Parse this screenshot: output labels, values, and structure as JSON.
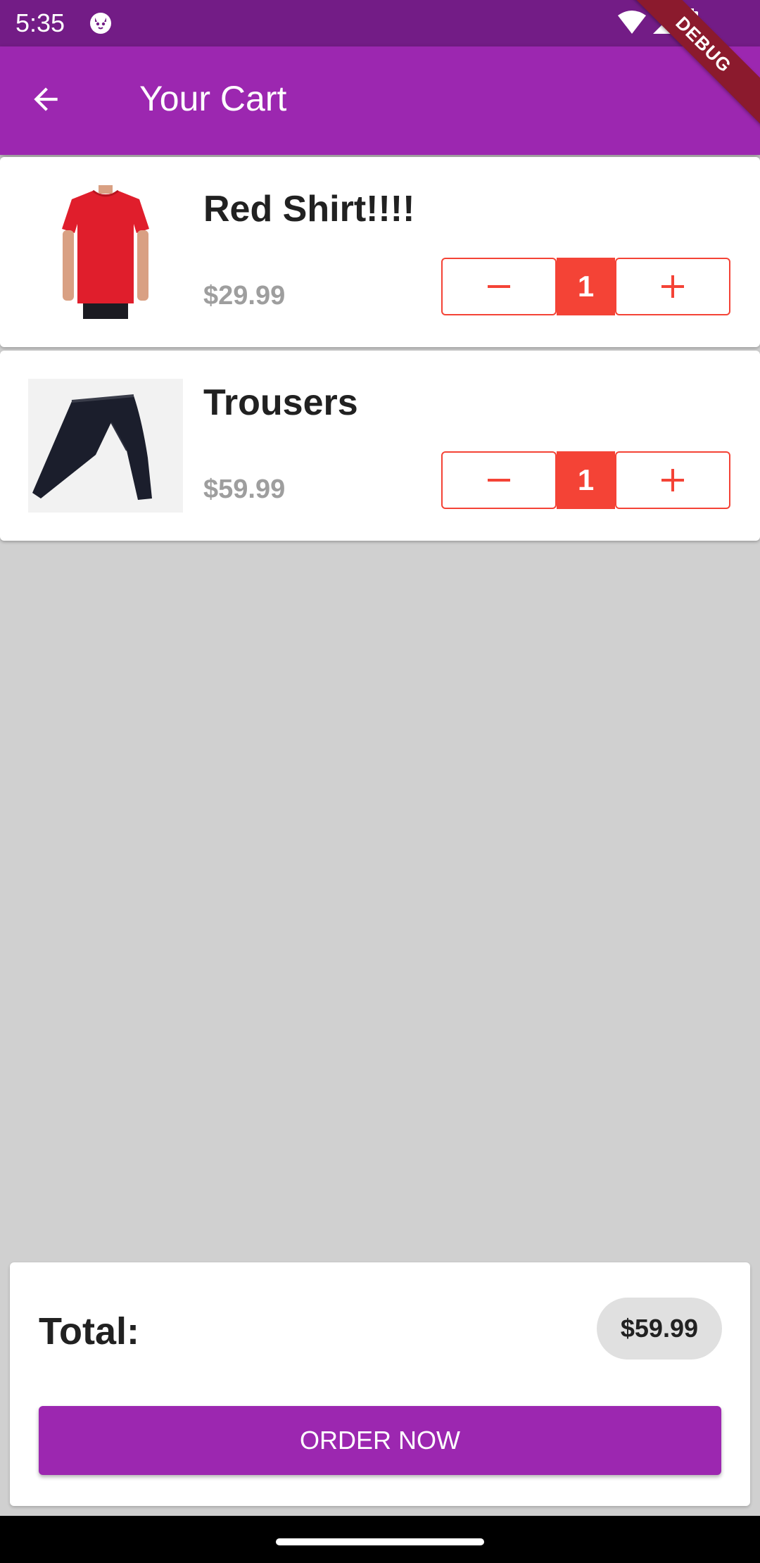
{
  "status_bar": {
    "time": "5:35",
    "icons": [
      "cat-notification-icon",
      "wifi-icon",
      "signal-icon",
      "battery-icon"
    ]
  },
  "app_bar": {
    "title": "Your Cart",
    "back_icon": "arrow-back-icon",
    "background": "#9c27b0"
  },
  "debug_banner": "DEBUG",
  "cart": {
    "items": [
      {
        "name": "Red Shirt!!!!",
        "price": "$29.99",
        "quantity": "1",
        "image": "red-shirt-image"
      },
      {
        "name": "Trousers",
        "price": "$59.99",
        "quantity": "1",
        "image": "trousers-image"
      }
    ]
  },
  "summary": {
    "total_label": "Total:",
    "total_value": "$59.99",
    "order_button": "ORDER NOW"
  },
  "colors": {
    "primary": "#9c27b0",
    "status_bar": "#731c86",
    "accent_red": "#f44336",
    "background": "#d0d0d0"
  }
}
